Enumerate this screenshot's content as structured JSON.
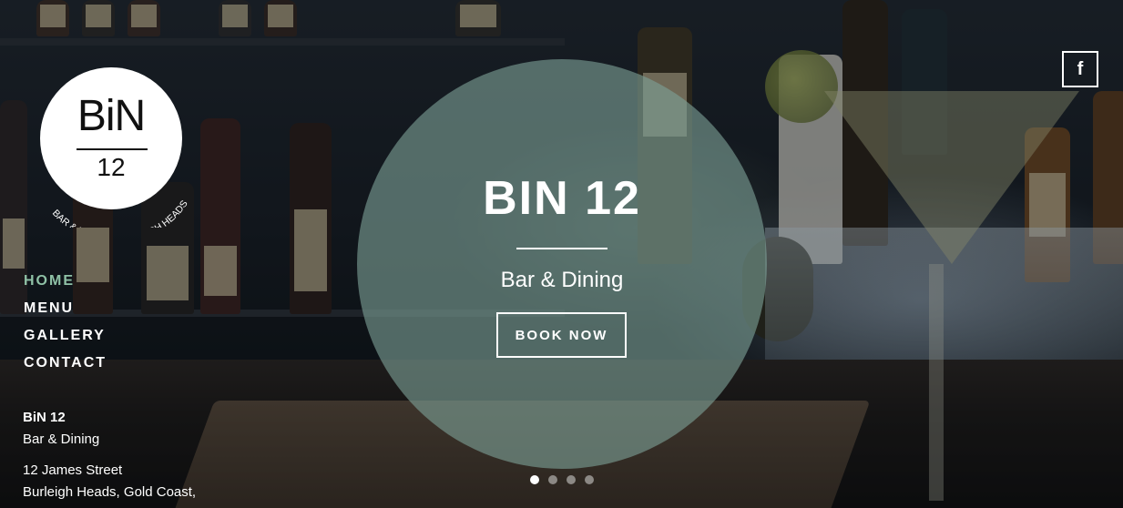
{
  "brand": {
    "logo_main": "BiN",
    "logo_number": "12",
    "logo_tagline": "BAR & DINING | BURLEIGH HEADS"
  },
  "hero": {
    "title": "BIN 12",
    "subtitle": "Bar & Dining",
    "cta_label": "BOOK NOW"
  },
  "nav": {
    "items": [
      {
        "label": "HOME",
        "active": true
      },
      {
        "label": "MENU",
        "active": false
      },
      {
        "label": "GALLERY",
        "active": false
      },
      {
        "label": "CONTACT",
        "active": false
      }
    ]
  },
  "info": {
    "name": "BiN 12",
    "descriptor": "Bar & Dining",
    "address_line1": "12 James Street",
    "address_line2": "Burleigh Heads, Gold Coast,"
  },
  "social": {
    "facebook_icon": "facebook-icon",
    "facebook_glyph": "f"
  },
  "slider": {
    "slide_count": 4,
    "active_slide": 1
  },
  "colors": {
    "accent_nav": "#8fc1a6",
    "hero_circle": "#7da096"
  }
}
